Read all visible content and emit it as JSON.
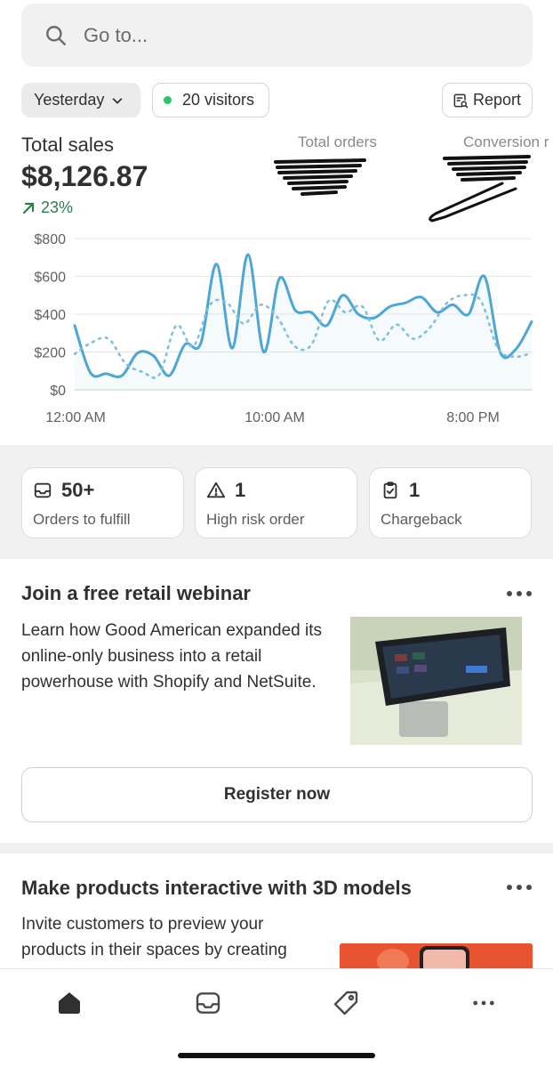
{
  "search": {
    "placeholder": "Go to...",
    "icon": "search-icon"
  },
  "filters": {
    "date_label": "Yesterday",
    "visitors_label": "20 visitors",
    "report_label": "Report"
  },
  "metrics": {
    "total_sales_label": "Total sales",
    "total_sales_value": "$8,126.87",
    "total_sales_change": "23%",
    "total_orders_label": "Total orders",
    "conversion_label": "Conversion r"
  },
  "chart_data": {
    "type": "line",
    "y_ticks": [
      "$800",
      "$600",
      "$400",
      "$200",
      "$0"
    ],
    "x_ticks": [
      "12:00 AM",
      "10:00 AM",
      "8:00 PM"
    ],
    "ylim": [
      0,
      800
    ],
    "series": [
      {
        "style": "solid",
        "color": "#4ea6d6",
        "values": [
          340,
          90,
          85,
          75,
          195,
          180,
          75,
          240,
          245,
          665,
          220,
          715,
          200,
          590,
          420,
          410,
          340,
          500,
          400,
          380,
          440,
          460,
          490,
          410,
          450,
          400,
          600,
          200,
          215,
          360
        ]
      },
      {
        "style": "dotted",
        "color": "#7fbfe0",
        "values": [
          190,
          250,
          270,
          140,
          95,
          80,
          340,
          230,
          450,
          460,
          350,
          450,
          380,
          230,
          240,
          470,
          410,
          440,
          260,
          345,
          270,
          330,
          460,
          500,
          470,
          220,
          175,
          195
        ]
      }
    ]
  },
  "cards": [
    {
      "icon": "inbox-icon",
      "value": "50+",
      "label": "Orders to fulfill"
    },
    {
      "icon": "alert-triangle-icon",
      "value": "1",
      "label": "High risk order"
    },
    {
      "icon": "clipboard-check-icon",
      "value": "1",
      "label": "Chargeback"
    }
  ],
  "webinar": {
    "title": "Join a free retail webinar",
    "body": "Learn how Good American expanded its online-only business into a retail powerhouse with Shopify and NetSuite.",
    "button": "Register now"
  },
  "models": {
    "title": "Make products interactive with 3D models",
    "body": "Invite customers to preview your products in their spaces by creating"
  },
  "tabbar": [
    "home-icon",
    "orders-inbox-icon",
    "products-tag-icon",
    "more-icon"
  ]
}
